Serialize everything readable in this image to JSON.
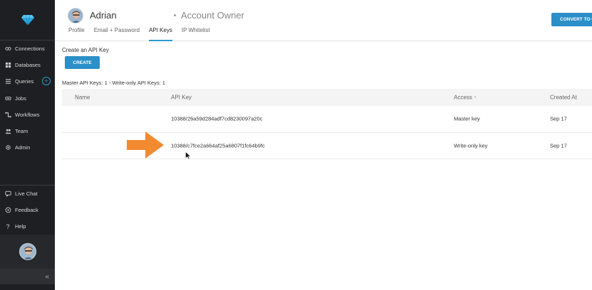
{
  "sidebar": {
    "items": [
      {
        "label": "Connections",
        "icon": "connections-icon"
      },
      {
        "label": "Databases",
        "icon": "databases-icon"
      },
      {
        "label": "Queries",
        "icon": "queries-icon"
      },
      {
        "label": "Jobs",
        "icon": "jobs-icon"
      },
      {
        "label": "Workflows",
        "icon": "workflows-icon"
      },
      {
        "label": "Team",
        "icon": "team-icon"
      },
      {
        "label": "Admin",
        "icon": "admin-icon"
      }
    ],
    "bottom_items": [
      {
        "label": "Live Chat",
        "icon": "chat-icon"
      },
      {
        "label": "Feedback",
        "icon": "feedback-icon"
      },
      {
        "label": "Help",
        "icon": "help-icon"
      }
    ],
    "collapse_glyph": "«"
  },
  "header": {
    "user_name": "Adrian",
    "role": "Account Owner",
    "tabs": [
      {
        "label": "Profile",
        "active": false
      },
      {
        "label": "Email + Password",
        "active": false
      },
      {
        "label": "API Keys",
        "active": true
      },
      {
        "label": "IP Whitelist",
        "active": false
      }
    ],
    "convert_button": "CONVERT TO O"
  },
  "main": {
    "create_label": "Create an API Key",
    "create_button": "CREATE",
    "counts": "Master API Keys: 1 - Write-only API Keys: 1",
    "columns": {
      "name": "Name",
      "api_key": "API Key",
      "access": "Access",
      "created_at": "Created At"
    },
    "sort_glyph": "^",
    "rows": [
      {
        "name": "",
        "api_key": "10388/26a59d284adf7cd8230097a20c",
        "access": "Master key",
        "created_at": "Sep 17"
      },
      {
        "name": "",
        "api_key": "10388/c7fce2a664af25a6807f1fc64b9fc",
        "access": "Write-only key",
        "created_at": "Sep 17"
      }
    ]
  },
  "colors": {
    "accent": "#2b8fc8",
    "sidebar_bg": "#1e1f22",
    "arrow": "#f28a30",
    "logo": "#29a8e0"
  }
}
